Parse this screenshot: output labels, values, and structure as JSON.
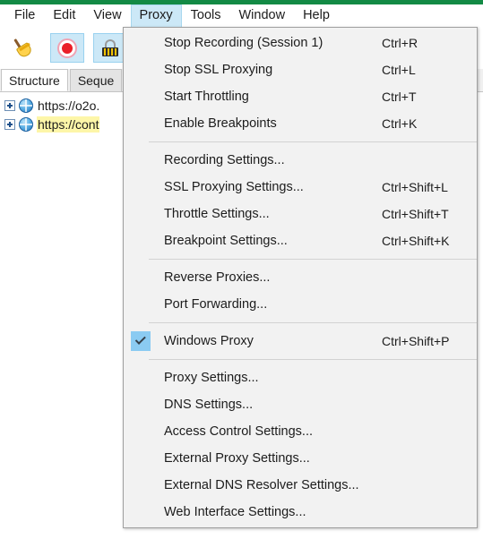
{
  "window": {
    "accent_color": "#138a45",
    "background": "#ffffff"
  },
  "menubar": {
    "items": [
      {
        "label": "File",
        "open": false
      },
      {
        "label": "Edit",
        "open": false
      },
      {
        "label": "View",
        "open": false
      },
      {
        "label": "Proxy",
        "open": true
      },
      {
        "label": "Tools",
        "open": false
      },
      {
        "label": "Window",
        "open": false
      },
      {
        "label": "Help",
        "open": false
      }
    ],
    "highlight_color": "#cce8f7"
  },
  "toolbar": {
    "buttons": [
      {
        "name": "clear-session-button",
        "icon": "broom-icon",
        "active": false
      },
      {
        "name": "record-toggle-button",
        "icon": "record-icon",
        "active": true
      },
      {
        "name": "ssl-proxying-button",
        "icon": "lock-icon",
        "active": true
      }
    ]
  },
  "tabs": [
    {
      "label": "Structure",
      "active": true
    },
    {
      "label": "Seque",
      "active": false
    }
  ],
  "tree": {
    "rows": [
      {
        "label": "https://o2o.",
        "highlighted": false
      },
      {
        "label": "https://cont",
        "highlighted": true
      }
    ],
    "highlight_color": "#fdf6a8"
  },
  "dropdown": {
    "owner": "Proxy",
    "check_color": "#8bcbf2",
    "groups": [
      {
        "items": [
          {
            "label": "Stop Recording (Session 1)",
            "accel": "Ctrl+R",
            "checked": false
          },
          {
            "label": "Stop SSL Proxying",
            "accel": "Ctrl+L",
            "checked": false
          },
          {
            "label": "Start Throttling",
            "accel": "Ctrl+T",
            "checked": false
          },
          {
            "label": "Enable Breakpoints",
            "accel": "Ctrl+K",
            "checked": false
          }
        ]
      },
      {
        "items": [
          {
            "label": "Recording Settings...",
            "accel": "",
            "checked": false
          },
          {
            "label": "SSL Proxying Settings...",
            "accel": "Ctrl+Shift+L",
            "checked": false
          },
          {
            "label": "Throttle Settings...",
            "accel": "Ctrl+Shift+T",
            "checked": false
          },
          {
            "label": "Breakpoint Settings...",
            "accel": "Ctrl+Shift+K",
            "checked": false
          }
        ]
      },
      {
        "items": [
          {
            "label": "Reverse Proxies...",
            "accel": "",
            "checked": false
          },
          {
            "label": "Port Forwarding...",
            "accel": "",
            "checked": false
          }
        ]
      },
      {
        "items": [
          {
            "label": "Windows Proxy",
            "accel": "Ctrl+Shift+P",
            "checked": true
          }
        ]
      },
      {
        "items": [
          {
            "label": "Proxy Settings...",
            "accel": "",
            "checked": false
          },
          {
            "label": "DNS Settings...",
            "accel": "",
            "checked": false
          },
          {
            "label": "Access Control Settings...",
            "accel": "",
            "checked": false
          },
          {
            "label": "External Proxy Settings...",
            "accel": "",
            "checked": false
          },
          {
            "label": "External DNS Resolver Settings...",
            "accel": "",
            "checked": false
          },
          {
            "label": "Web Interface Settings...",
            "accel": "",
            "checked": false
          }
        ]
      }
    ]
  }
}
